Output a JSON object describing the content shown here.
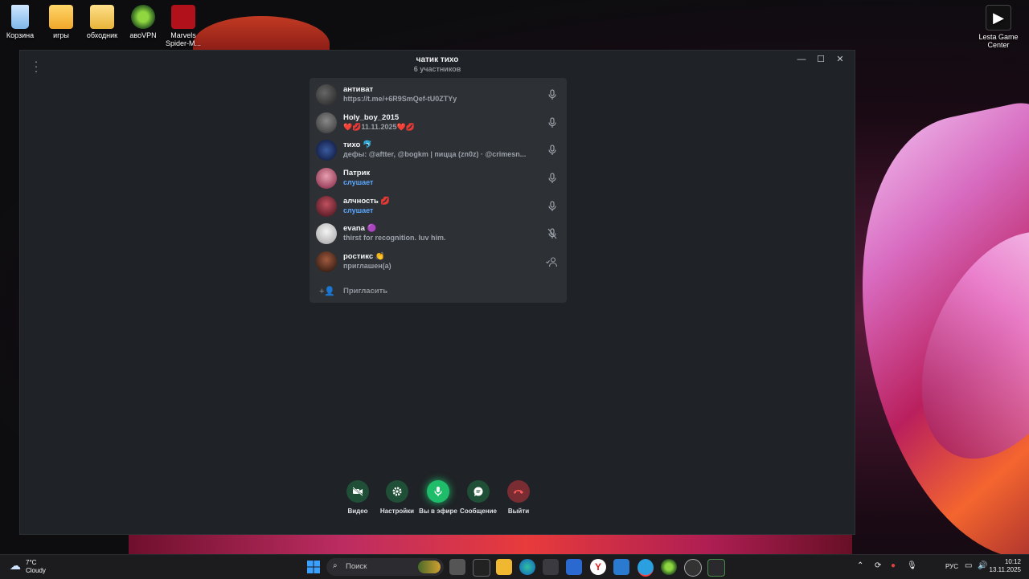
{
  "desktop": {
    "icons": [
      {
        "label": "Корзина",
        "icon": "recycle-bin-icon"
      },
      {
        "label": "игры",
        "icon": "folder-icon"
      },
      {
        "label": "обходник",
        "icon": "folder-icon"
      },
      {
        "label": "aвoVPN",
        "icon": "vpn-icon"
      },
      {
        "label": "Marvels Spider-M...",
        "icon": "spider-man-icon"
      },
      {
        "label": "Lesta Game Center",
        "icon": "lesta-icon"
      }
    ]
  },
  "call": {
    "title": "чатик тихо",
    "subtitle": "6 участников",
    "participants": [
      {
        "name": "антиват",
        "status": "https://t.me/+6R9SmQef-tU0ZTYy",
        "mic": "on"
      },
      {
        "name": "Holy_boy_2015",
        "status": "❤️💋11.11.2025❤️💋",
        "mic": "on"
      },
      {
        "name": "тихо 🐬",
        "status": "дефы: @aftter, @bogkm | пицца (zn0z) · @crimesn...",
        "mic": "on"
      },
      {
        "name": "Патрик",
        "status": "слушает",
        "mic": "on",
        "listening": true
      },
      {
        "name": "алчность 💋",
        "status": "слушает",
        "mic": "on",
        "listening": true
      },
      {
        "name": "evana 🟣",
        "status": "thirst for recognition. luv him.",
        "mic": "muted"
      },
      {
        "name": "ростикс 👏",
        "status": "приглашен(а)",
        "mic": "invited"
      }
    ],
    "invite_label": "Пригласить",
    "controls": [
      {
        "label": "Видео",
        "color": "#1f4f36",
        "icon": "video-off-icon"
      },
      {
        "label": "Настройки",
        "color": "#1f4f36",
        "icon": "gear-icon"
      },
      {
        "label": "Вы в эфире",
        "color": "#1fbd6a",
        "icon": "mic-icon"
      },
      {
        "label": "Сообщение",
        "color": "#1f4f36",
        "icon": "message-icon"
      },
      {
        "label": "Выйти",
        "color": "#7a2c33",
        "icon": "hang-up-icon"
      }
    ]
  },
  "taskbar": {
    "weather_temp": "7°C",
    "weather_desc": "Cloudy",
    "search_placeholder": "Поиск",
    "language": "РУС",
    "time": "10:12",
    "date": "13.11.2025"
  },
  "colors": {
    "window_bg": "#1f2226",
    "panel_bg": "#2d3035",
    "accent_green": "#1fbd6a",
    "listening_blue": "#5aa8ff",
    "leave_red": "#7a2c33"
  }
}
